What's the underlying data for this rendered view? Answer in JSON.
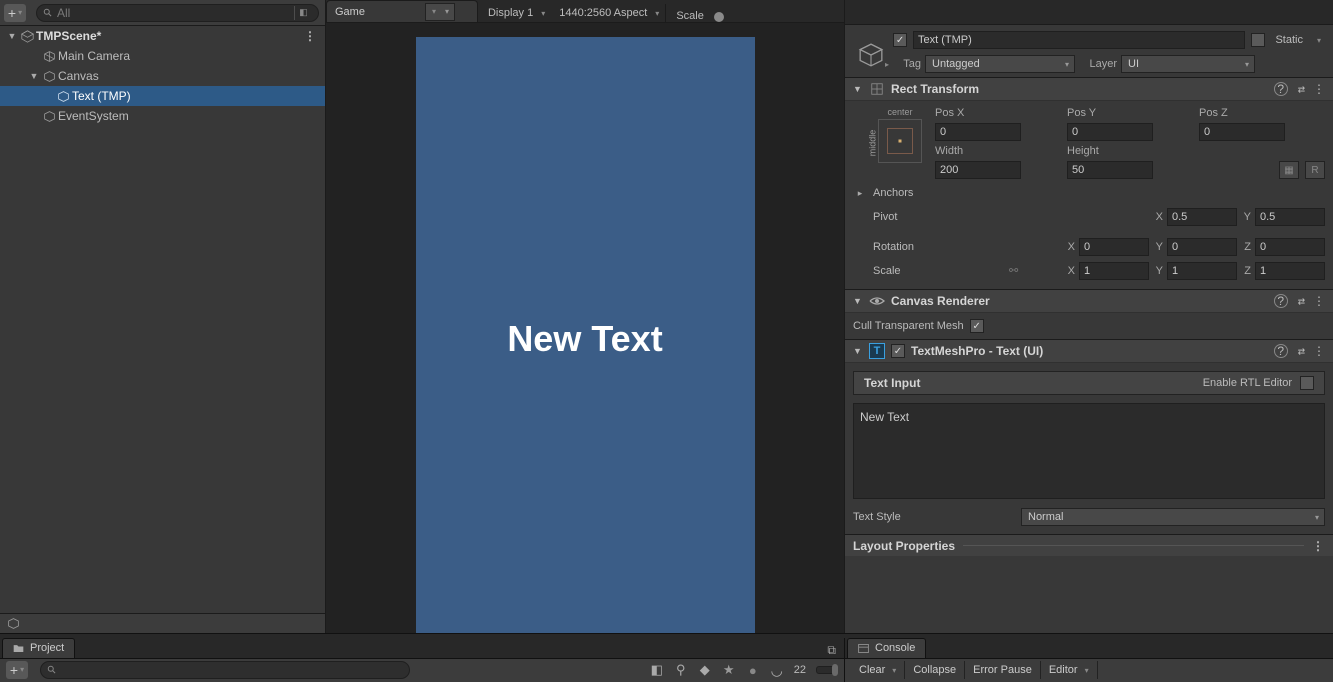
{
  "hierarchy": {
    "search_placeholder": "All",
    "scene": "TMPScene*",
    "items": [
      "Main Camera",
      "Canvas",
      "Text (TMP)",
      "EventSystem"
    ]
  },
  "gameview": {
    "tab": "Game",
    "display": "Display 1",
    "aspect": "1440:2560 Aspect",
    "scale_label": "Scale",
    "preview_text": "New Text"
  },
  "inspector": {
    "name": "Text (TMP)",
    "static_label": "Static",
    "tag_label": "Tag",
    "tag_value": "Untagged",
    "layer_label": "Layer",
    "layer_value": "UI",
    "rect": {
      "title": "Rect Transform",
      "anchor_h": "center",
      "anchor_v": "middle",
      "posx_l": "Pos X",
      "posy_l": "Pos Y",
      "posz_l": "Pos Z",
      "posx": "0",
      "posy": "0",
      "posz": "0",
      "width_l": "Width",
      "height_l": "Height",
      "width": "200",
      "height": "50",
      "anchors": "Anchors",
      "pivot": "Pivot",
      "pivx": "0.5",
      "pivy": "0.5",
      "rotation": "Rotation",
      "rx": "0",
      "ry": "0",
      "rz": "0",
      "scale": "Scale",
      "sx": "1",
      "sy": "1",
      "sz": "1"
    },
    "canvas_renderer": {
      "title": "Canvas Renderer",
      "cull": "Cull Transparent Mesh"
    },
    "tmp": {
      "title": "TextMeshPro - Text (UI)",
      "text_input": "Text Input",
      "rtl": "Enable RTL Editor",
      "text": "New Text",
      "text_style_l": "Text Style",
      "text_style_v": "Normal"
    },
    "layout_props": "Layout Properties"
  },
  "project": {
    "tab": "Project",
    "count": "22"
  },
  "console": {
    "tab": "Console",
    "clear": "Clear",
    "collapse": "Collapse",
    "error_pause": "Error Pause",
    "editor": "Editor"
  }
}
